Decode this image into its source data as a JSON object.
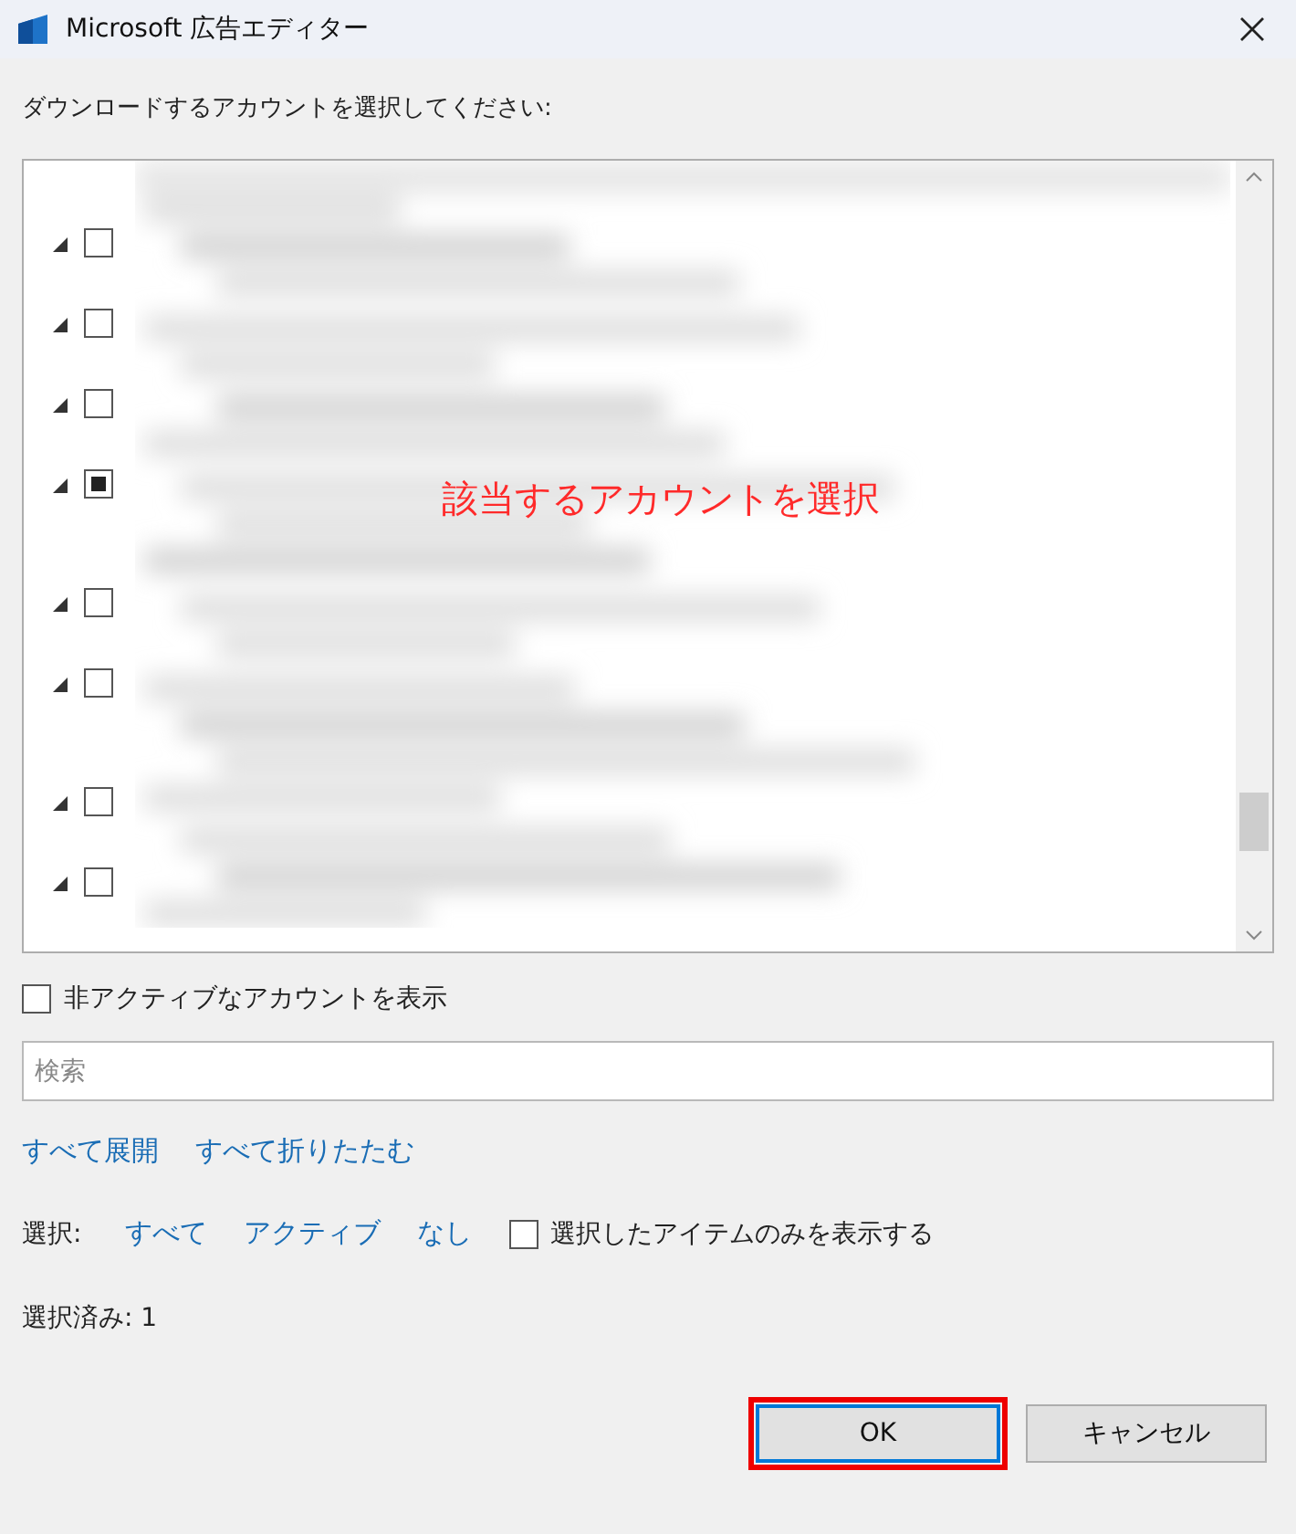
{
  "window": {
    "title": "Microsoft 広告エディター"
  },
  "prompt": "ダウンロードするアカウントを選択してください:",
  "account_tree": {
    "annotation": "該当するアカウントを選択",
    "rows": [
      {
        "expanded": true,
        "checked": false
      },
      {
        "expanded": true,
        "checked": false
      },
      {
        "expanded": true,
        "checked": false
      },
      {
        "expanded": true,
        "checked": true
      },
      {
        "expanded": true,
        "checked": false
      },
      {
        "expanded": true,
        "checked": false
      },
      {
        "expanded": true,
        "checked": false
      },
      {
        "expanded": true,
        "checked": false
      }
    ]
  },
  "show_inactive": {
    "label": "非アクティブなアカウントを表示",
    "checked": false
  },
  "search": {
    "placeholder": "検索"
  },
  "tree_links": [
    "すべて展開",
    "すべて折りたたむ"
  ],
  "selection": {
    "label": "選択:",
    "links": [
      "すべて",
      "アクティブ",
      "なし"
    ],
    "selected_only": {
      "label": "選択したアイテムのみを表示する",
      "checked": false
    }
  },
  "selected_count": "選択済み: 1",
  "buttons": [
    {
      "label": "OK",
      "kind": "primary",
      "highlighted": true
    },
    {
      "label": "キャンセル",
      "kind": "normal",
      "highlighted": false
    }
  ]
}
